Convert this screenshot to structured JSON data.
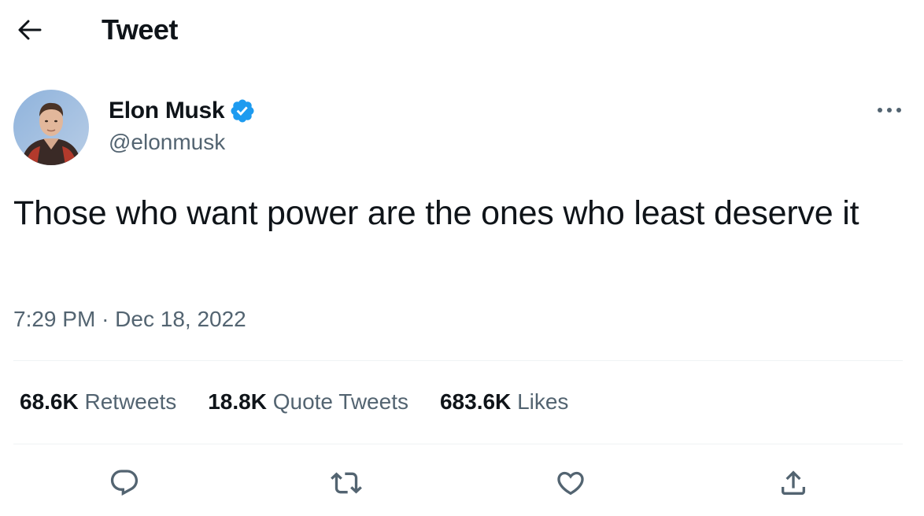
{
  "header": {
    "title": "Tweet",
    "back_icon": "arrow-left-icon"
  },
  "author": {
    "name": "Elon Musk",
    "handle": "@elonmusk",
    "verified": true,
    "verified_icon": "verified-badge-icon",
    "verified_color": "#1d9bf0"
  },
  "tweet": {
    "text": "Those who want power are the ones who least deserve it",
    "time": "7:29 PM",
    "separator": "·",
    "date": "Dec 18, 2022"
  },
  "stats": [
    {
      "number": "68.6K",
      "label": "Retweets"
    },
    {
      "number": "18.8K",
      "label": "Quote Tweets"
    },
    {
      "number": "683.6K",
      "label": "Likes"
    }
  ],
  "actions": [
    "reply-icon",
    "retweet-icon",
    "like-icon",
    "share-icon"
  ],
  "colors": {
    "text": "#0f1419",
    "secondary": "#536471",
    "divider": "#eff3f4",
    "accent": "#1d9bf0"
  }
}
